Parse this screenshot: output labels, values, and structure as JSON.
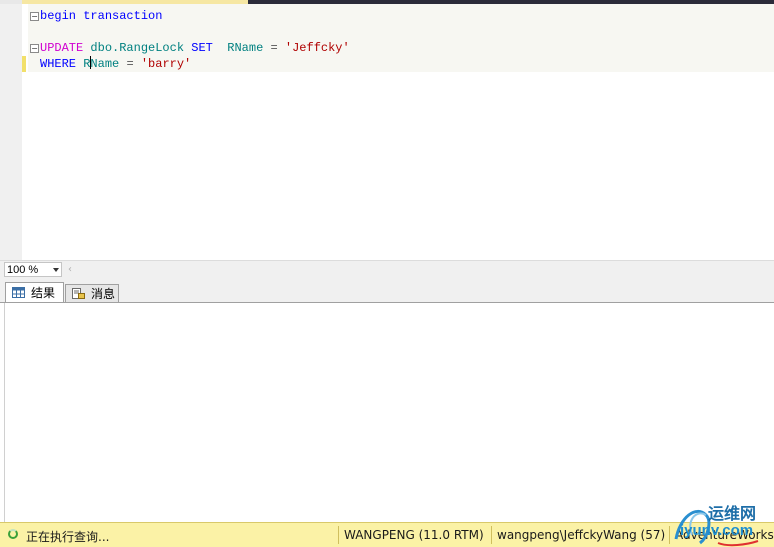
{
  "editor": {
    "line1": {
      "begin": "begin",
      "transaction": "transaction"
    },
    "line3": {
      "update": "UPDATE",
      "table": "dbo.RangeLock",
      "set": "SET",
      "col": "RName",
      "eq": "=",
      "value": "'Jeffcky'"
    },
    "line4": {
      "where": "WHERE",
      "col_a": "R",
      "col_b": "Name",
      "eq": "=",
      "value": "'barry'"
    }
  },
  "zoom": {
    "value": "100 %"
  },
  "results": {
    "tabs": [
      {
        "label": "结果",
        "icon": "grid-icon"
      },
      {
        "label": "消息",
        "icon": "message-icon"
      }
    ]
  },
  "status": {
    "message": "正在执行查询...",
    "server": "WANGPENG (11.0 RTM)",
    "user": "wangpeng\\JeffckyWang (57)",
    "database": "AdventureWorks"
  },
  "watermark": {
    "line1": "运维网",
    "line2": "iyunv.com"
  },
  "colors": {
    "keyword": "#0000ff",
    "update_keyword": "#d000d0",
    "identifier": "#008080",
    "string": "#b00000",
    "statusbar": "#fbf2a6"
  }
}
